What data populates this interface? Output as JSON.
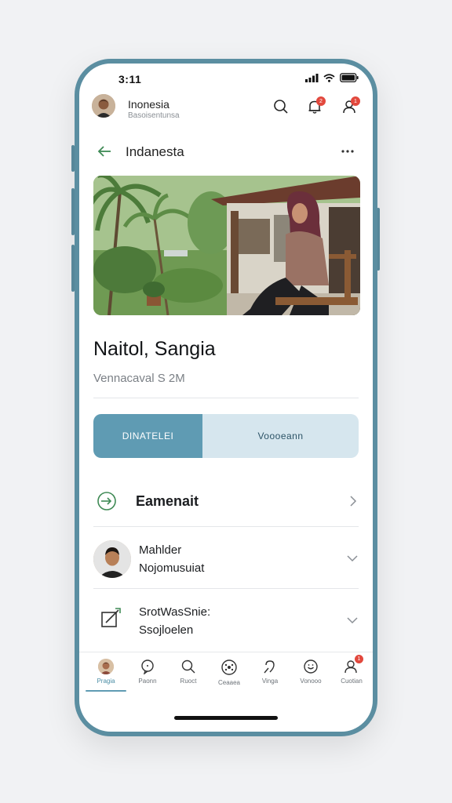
{
  "status": {
    "time": "3:11"
  },
  "app": {
    "title": "Inonesia",
    "subtitle": "Basoisentunsa",
    "notif_badge": "2",
    "profile_badge": "1"
  },
  "nav": {
    "title": "Indanesta"
  },
  "profile": {
    "name": "Naitol, Sangia",
    "meta": "Vennacaval S 2M"
  },
  "segments": {
    "active": "DINATELEI",
    "inactive": "Voooeann"
  },
  "rows": {
    "first": {
      "title": "Eamenait"
    },
    "contact": {
      "title": "Mahlder",
      "subtitle": "Nojomusuiat"
    },
    "edit": {
      "title": "SrotWasSnie:",
      "subtitle": "Ssojloelen"
    }
  },
  "tabs": [
    {
      "label": "Pragia",
      "icon": "avatar-icon"
    },
    {
      "label": "Paonn",
      "icon": "speech-bubble-icon"
    },
    {
      "label": "Ruoct",
      "icon": "search-icon"
    },
    {
      "label": "Ceaaea",
      "icon": "hub-icon"
    },
    {
      "label": "Vinga",
      "icon": "pin-icon"
    },
    {
      "label": "Vonooo",
      "icon": "face-icon"
    },
    {
      "label": "Cuotian",
      "icon": "person-icon",
      "badge": "1"
    }
  ],
  "colors": {
    "frame": "#5b8ea1",
    "accent": "#5f9bb3",
    "segment_bg": "#d6e6ee",
    "badge": "#e2483d",
    "back_arrow": "#3f8a55"
  }
}
